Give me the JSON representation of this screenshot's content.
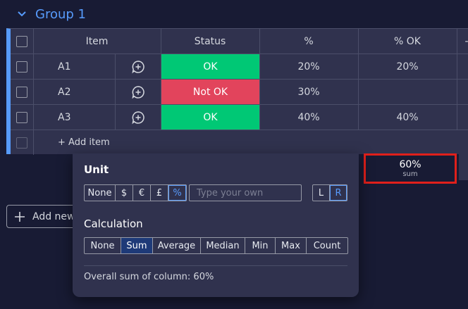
{
  "group": {
    "title": "Group 1"
  },
  "table": {
    "headers": {
      "item": "Item",
      "status": "Status",
      "percent": "%",
      "percent_ok": "% OK",
      "more": "-"
    },
    "rows": [
      {
        "item": "A1",
        "status": "OK",
        "percent": "20%",
        "percent_ok": "20%"
      },
      {
        "item": "A2",
        "status": "Not OK",
        "percent": "30%",
        "percent_ok": ""
      },
      {
        "item": "A3",
        "status": "OK",
        "percent": "40%",
        "percent_ok": "40%"
      }
    ],
    "add_item": "+ Add item"
  },
  "summary": {
    "value": "60%",
    "label": "sum"
  },
  "add_new": {
    "label": "Add new"
  },
  "popup": {
    "unit_title": "Unit",
    "unit_options": [
      "None",
      "$",
      "€",
      "£",
      "%"
    ],
    "unit_selected": "%",
    "unit_placeholder": "Type your own",
    "direction_options": [
      "L",
      "R"
    ],
    "direction_selected": "R",
    "calc_title": "Calculation",
    "calc_options": [
      "None",
      "Sum",
      "Average",
      "Median",
      "Min",
      "Max",
      "Count"
    ],
    "calc_selected": "Sum",
    "overall": "Overall sum of column: 60%"
  },
  "colors": {
    "accent": "#579bfc",
    "ok": "#00c875",
    "not_ok": "#e2445c",
    "highlight": "#e0201b"
  }
}
